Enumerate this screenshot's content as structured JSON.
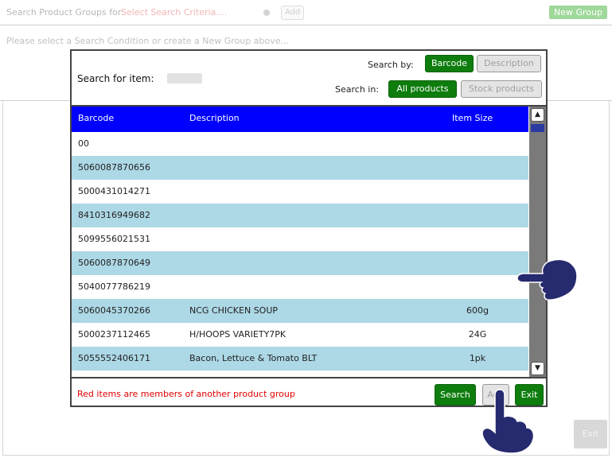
{
  "page": {
    "search_label": "Search Product Groups for:",
    "search_criteria": "Select Search Criteria....",
    "add_label": "Add",
    "new_group_label": "New Group",
    "empty_message": "Please select a Search Condition or create a New Group above...",
    "exit_label": "Exit"
  },
  "modal": {
    "search_for_label": "Search for item:",
    "search_by_label": "Search by:",
    "search_in_label": "Search in:",
    "search_by_options": [
      "Barcode",
      "Description"
    ],
    "search_by_selected": "Barcode",
    "search_in_options": [
      "All products",
      "Stock products"
    ],
    "search_in_selected": "All products",
    "columns": [
      "Barcode",
      "Description",
      "Item Size"
    ],
    "rows": [
      {
        "barcode": "00",
        "description": "",
        "size": ""
      },
      {
        "barcode": "5060087870656",
        "description": "",
        "size": ""
      },
      {
        "barcode": "5000431014271",
        "description": "",
        "size": ""
      },
      {
        "barcode": "8410316949682",
        "description": "",
        "size": ""
      },
      {
        "barcode": "5099556021531",
        "description": "",
        "size": ""
      },
      {
        "barcode": "5060087870649",
        "description": "",
        "size": ""
      },
      {
        "barcode": "5040077786219",
        "description": "",
        "size": ""
      },
      {
        "barcode": "5060045370266",
        "description": "NCG CHICKEN SOUP",
        "size": "600g"
      },
      {
        "barcode": "5000237112465",
        "description": "H/HOOPS VARIETY7PK",
        "size": "24G"
      },
      {
        "barcode": "5055552406171",
        "description": "Bacon, Lettuce & Tomato BLT",
        "size": "1pk"
      }
    ],
    "footer_message": "Red items are members of another product group",
    "search_button": "Search",
    "add_button": "Add",
    "exit_button": "Exit"
  },
  "colors": {
    "header_bg": "#0000ff",
    "alt_row": "#add8e6",
    "green_button": "#0e7d0e",
    "footer_text": "#e00000",
    "hand_cursor": "#262a6e"
  },
  "icons": {
    "hand_right": "pointing-hand-icon",
    "hand_bottom": "pointing-hand-icon",
    "scroll_up": "up-arrow-icon",
    "scroll_down": "down-arrow-icon",
    "criteria_toggle": "toggle-icon"
  }
}
